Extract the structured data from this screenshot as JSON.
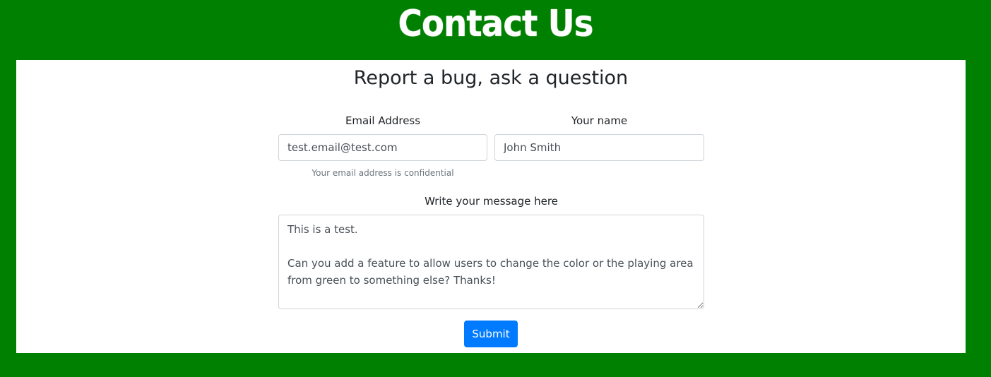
{
  "header": {
    "title": "Contact Us"
  },
  "form": {
    "heading": "Report a bug, ask a question",
    "email": {
      "label": "Email Address",
      "value": "test.email@test.com",
      "help": "Your email address is confidential"
    },
    "name": {
      "label": "Your name",
      "value": "John Smith"
    },
    "message": {
      "label": "Write your message here",
      "value": "This is a test.\n\nCan you add a feature to allow users to change the color or the playing area from green to something else? Thanks!"
    },
    "submit_label": "Submit"
  },
  "colors": {
    "background": "#008000",
    "panel": "#ffffff",
    "button": "#007bff"
  }
}
